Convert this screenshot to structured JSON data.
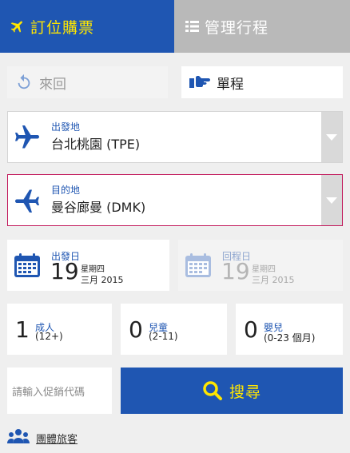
{
  "tabs": {
    "book_label": "訂位購票",
    "manage_label": "管理行程"
  },
  "trip_type": {
    "round_label": "來回",
    "oneway_label": "單程"
  },
  "origin": {
    "caption": "出發地",
    "value": "台北桃園 (TPE)"
  },
  "destination": {
    "caption": "目的地",
    "value": "曼谷廊曼 (DMK)"
  },
  "departure_date": {
    "caption": "出發日",
    "day": "19",
    "weekday": "星期四",
    "month_year": "三月 2015"
  },
  "return_date": {
    "caption": "回程日",
    "day": "19",
    "weekday": "星期四",
    "month_year": "三月 2015"
  },
  "passengers": {
    "adult": {
      "count": "1",
      "label": "成人",
      "range": "(12+)"
    },
    "child": {
      "count": "0",
      "label": "兒童",
      "range": "(2-11)"
    },
    "infant": {
      "count": "0",
      "label": "嬰兒",
      "range": "(0-23 個月)"
    }
  },
  "promo": {
    "placeholder": "請輸入促銷代碼"
  },
  "search": {
    "label": "搜尋"
  },
  "group": {
    "label": "團體旅客"
  },
  "colors": {
    "brand_blue": "#1f56b2",
    "accent_yellow": "#ffe600",
    "highlight_border": "#c2185b"
  }
}
